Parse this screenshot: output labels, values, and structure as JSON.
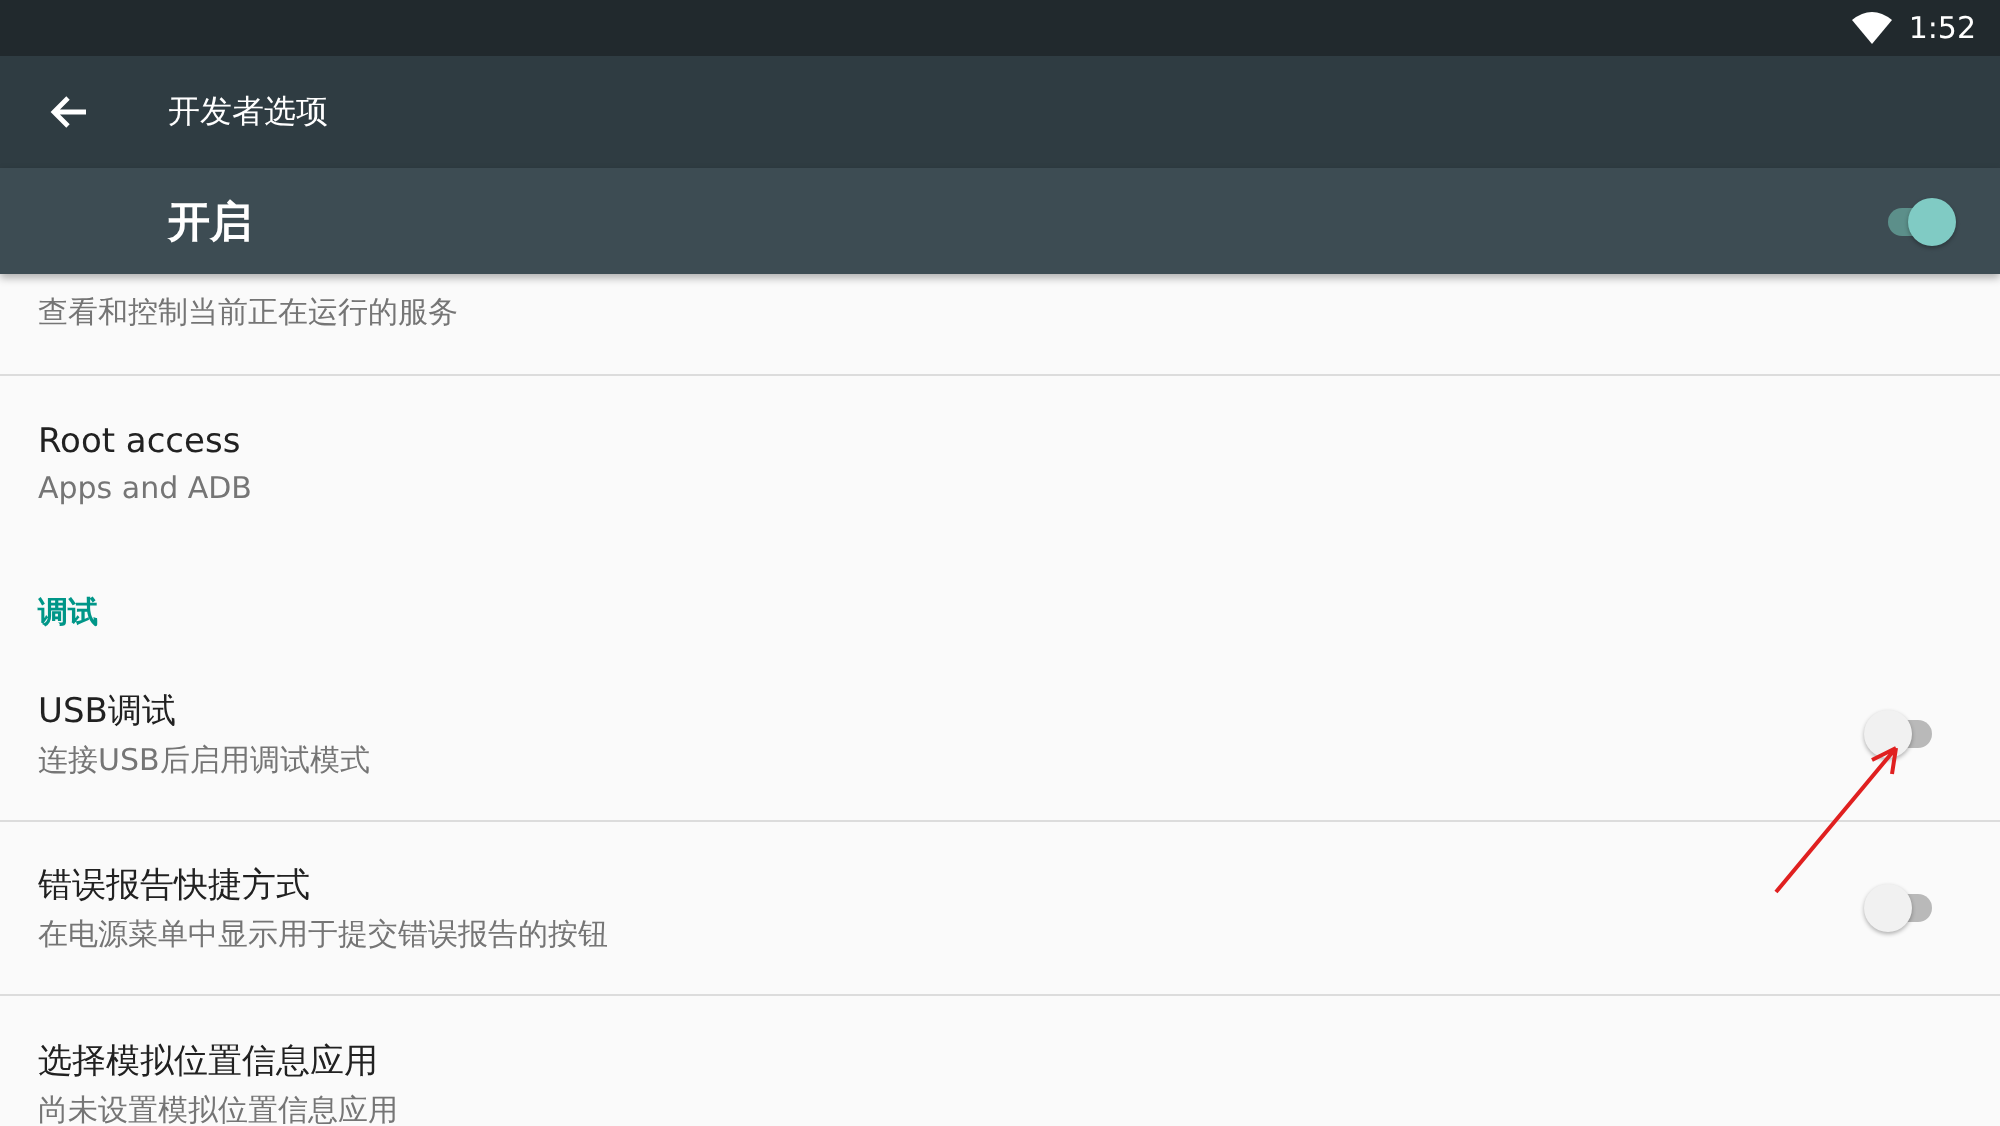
{
  "status_bar": {
    "time": "1:52"
  },
  "toolbar": {
    "title": "开发者选项"
  },
  "master_switch": {
    "label": "开启",
    "on": true
  },
  "items": [
    {
      "kind": "setting",
      "summary": "查看和控制当前正在运行的服务"
    },
    {
      "kind": "setting",
      "title": "Root access",
      "summary": "Apps and ADB"
    },
    {
      "kind": "header",
      "title": "调试"
    },
    {
      "kind": "toggle",
      "title": "USB调试",
      "summary": "连接USB后启用调试模式",
      "on": false
    },
    {
      "kind": "toggle",
      "title": "错误报告快捷方式",
      "summary": "在电源菜单中显示用于提交错误报告的按钮",
      "on": false
    },
    {
      "kind": "setting",
      "title": "选择模拟位置信息应用",
      "summary": "尚未设置模拟位置信息应用"
    }
  ]
}
